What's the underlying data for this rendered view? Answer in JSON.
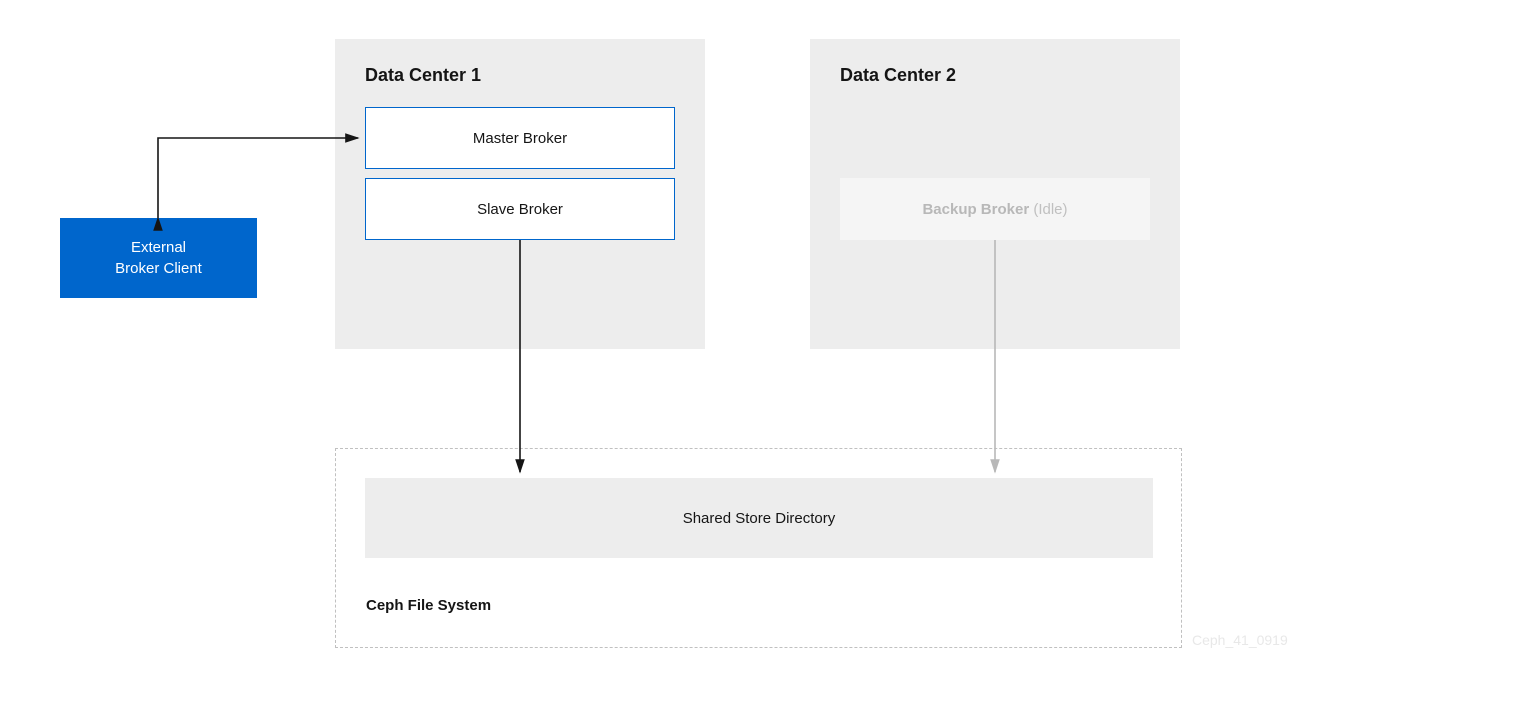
{
  "dc1": {
    "title": "Data Center 1"
  },
  "dc2": {
    "title": "Data Center 2"
  },
  "brokers": {
    "master": "Master Broker",
    "slave": "Slave Broker",
    "backup_name": "Backup Broker",
    "backup_state": "(Idle)"
  },
  "client": {
    "line1": "External",
    "line2": "Broker Client"
  },
  "ceph": {
    "title": "Ceph File System",
    "shared": "Shared Store Directory",
    "id": "Ceph_41_0919"
  }
}
